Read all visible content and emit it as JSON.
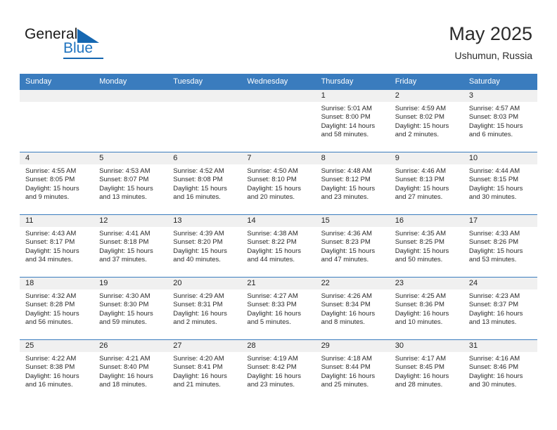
{
  "brand": {
    "name_part1": "General",
    "name_part2": "Blue",
    "logo_icon": "triangle-icon"
  },
  "header": {
    "title": "May 2025",
    "location": "Ushumun, Russia"
  },
  "colors": {
    "header_blue": "#3a7cbe",
    "brand_blue": "#1667b1",
    "daynum_band": "#f0f0f0",
    "text": "#2a2a2a"
  },
  "weekdays": [
    "Sunday",
    "Monday",
    "Tuesday",
    "Wednesday",
    "Thursday",
    "Friday",
    "Saturday"
  ],
  "weeks": [
    [
      {
        "day": "",
        "sunrise": "",
        "sunset": "",
        "daylight_line1": "",
        "daylight_line2": ""
      },
      {
        "day": "",
        "sunrise": "",
        "sunset": "",
        "daylight_line1": "",
        "daylight_line2": ""
      },
      {
        "day": "",
        "sunrise": "",
        "sunset": "",
        "daylight_line1": "",
        "daylight_line2": ""
      },
      {
        "day": "",
        "sunrise": "",
        "sunset": "",
        "daylight_line1": "",
        "daylight_line2": ""
      },
      {
        "day": "1",
        "sunrise": "Sunrise: 5:01 AM",
        "sunset": "Sunset: 8:00 PM",
        "daylight_line1": "Daylight: 14 hours",
        "daylight_line2": "and 58 minutes."
      },
      {
        "day": "2",
        "sunrise": "Sunrise: 4:59 AM",
        "sunset": "Sunset: 8:02 PM",
        "daylight_line1": "Daylight: 15 hours",
        "daylight_line2": "and 2 minutes."
      },
      {
        "day": "3",
        "sunrise": "Sunrise: 4:57 AM",
        "sunset": "Sunset: 8:03 PM",
        "daylight_line1": "Daylight: 15 hours",
        "daylight_line2": "and 6 minutes."
      }
    ],
    [
      {
        "day": "4",
        "sunrise": "Sunrise: 4:55 AM",
        "sunset": "Sunset: 8:05 PM",
        "daylight_line1": "Daylight: 15 hours",
        "daylight_line2": "and 9 minutes."
      },
      {
        "day": "5",
        "sunrise": "Sunrise: 4:53 AM",
        "sunset": "Sunset: 8:07 PM",
        "daylight_line1": "Daylight: 15 hours",
        "daylight_line2": "and 13 minutes."
      },
      {
        "day": "6",
        "sunrise": "Sunrise: 4:52 AM",
        "sunset": "Sunset: 8:08 PM",
        "daylight_line1": "Daylight: 15 hours",
        "daylight_line2": "and 16 minutes."
      },
      {
        "day": "7",
        "sunrise": "Sunrise: 4:50 AM",
        "sunset": "Sunset: 8:10 PM",
        "daylight_line1": "Daylight: 15 hours",
        "daylight_line2": "and 20 minutes."
      },
      {
        "day": "8",
        "sunrise": "Sunrise: 4:48 AM",
        "sunset": "Sunset: 8:12 PM",
        "daylight_line1": "Daylight: 15 hours",
        "daylight_line2": "and 23 minutes."
      },
      {
        "day": "9",
        "sunrise": "Sunrise: 4:46 AM",
        "sunset": "Sunset: 8:13 PM",
        "daylight_line1": "Daylight: 15 hours",
        "daylight_line2": "and 27 minutes."
      },
      {
        "day": "10",
        "sunrise": "Sunrise: 4:44 AM",
        "sunset": "Sunset: 8:15 PM",
        "daylight_line1": "Daylight: 15 hours",
        "daylight_line2": "and 30 minutes."
      }
    ],
    [
      {
        "day": "11",
        "sunrise": "Sunrise: 4:43 AM",
        "sunset": "Sunset: 8:17 PM",
        "daylight_line1": "Daylight: 15 hours",
        "daylight_line2": "and 34 minutes."
      },
      {
        "day": "12",
        "sunrise": "Sunrise: 4:41 AM",
        "sunset": "Sunset: 8:18 PM",
        "daylight_line1": "Daylight: 15 hours",
        "daylight_line2": "and 37 minutes."
      },
      {
        "day": "13",
        "sunrise": "Sunrise: 4:39 AM",
        "sunset": "Sunset: 8:20 PM",
        "daylight_line1": "Daylight: 15 hours",
        "daylight_line2": "and 40 minutes."
      },
      {
        "day": "14",
        "sunrise": "Sunrise: 4:38 AM",
        "sunset": "Sunset: 8:22 PM",
        "daylight_line1": "Daylight: 15 hours",
        "daylight_line2": "and 44 minutes."
      },
      {
        "day": "15",
        "sunrise": "Sunrise: 4:36 AM",
        "sunset": "Sunset: 8:23 PM",
        "daylight_line1": "Daylight: 15 hours",
        "daylight_line2": "and 47 minutes."
      },
      {
        "day": "16",
        "sunrise": "Sunrise: 4:35 AM",
        "sunset": "Sunset: 8:25 PM",
        "daylight_line1": "Daylight: 15 hours",
        "daylight_line2": "and 50 minutes."
      },
      {
        "day": "17",
        "sunrise": "Sunrise: 4:33 AM",
        "sunset": "Sunset: 8:26 PM",
        "daylight_line1": "Daylight: 15 hours",
        "daylight_line2": "and 53 minutes."
      }
    ],
    [
      {
        "day": "18",
        "sunrise": "Sunrise: 4:32 AM",
        "sunset": "Sunset: 8:28 PM",
        "daylight_line1": "Daylight: 15 hours",
        "daylight_line2": "and 56 minutes."
      },
      {
        "day": "19",
        "sunrise": "Sunrise: 4:30 AM",
        "sunset": "Sunset: 8:30 PM",
        "daylight_line1": "Daylight: 15 hours",
        "daylight_line2": "and 59 minutes."
      },
      {
        "day": "20",
        "sunrise": "Sunrise: 4:29 AM",
        "sunset": "Sunset: 8:31 PM",
        "daylight_line1": "Daylight: 16 hours",
        "daylight_line2": "and 2 minutes."
      },
      {
        "day": "21",
        "sunrise": "Sunrise: 4:27 AM",
        "sunset": "Sunset: 8:33 PM",
        "daylight_line1": "Daylight: 16 hours",
        "daylight_line2": "and 5 minutes."
      },
      {
        "day": "22",
        "sunrise": "Sunrise: 4:26 AM",
        "sunset": "Sunset: 8:34 PM",
        "daylight_line1": "Daylight: 16 hours",
        "daylight_line2": "and 8 minutes."
      },
      {
        "day": "23",
        "sunrise": "Sunrise: 4:25 AM",
        "sunset": "Sunset: 8:36 PM",
        "daylight_line1": "Daylight: 16 hours",
        "daylight_line2": "and 10 minutes."
      },
      {
        "day": "24",
        "sunrise": "Sunrise: 4:23 AM",
        "sunset": "Sunset: 8:37 PM",
        "daylight_line1": "Daylight: 16 hours",
        "daylight_line2": "and 13 minutes."
      }
    ],
    [
      {
        "day": "25",
        "sunrise": "Sunrise: 4:22 AM",
        "sunset": "Sunset: 8:38 PM",
        "daylight_line1": "Daylight: 16 hours",
        "daylight_line2": "and 16 minutes."
      },
      {
        "day": "26",
        "sunrise": "Sunrise: 4:21 AM",
        "sunset": "Sunset: 8:40 PM",
        "daylight_line1": "Daylight: 16 hours",
        "daylight_line2": "and 18 minutes."
      },
      {
        "day": "27",
        "sunrise": "Sunrise: 4:20 AM",
        "sunset": "Sunset: 8:41 PM",
        "daylight_line1": "Daylight: 16 hours",
        "daylight_line2": "and 21 minutes."
      },
      {
        "day": "28",
        "sunrise": "Sunrise: 4:19 AM",
        "sunset": "Sunset: 8:42 PM",
        "daylight_line1": "Daylight: 16 hours",
        "daylight_line2": "and 23 minutes."
      },
      {
        "day": "29",
        "sunrise": "Sunrise: 4:18 AM",
        "sunset": "Sunset: 8:44 PM",
        "daylight_line1": "Daylight: 16 hours",
        "daylight_line2": "and 25 minutes."
      },
      {
        "day": "30",
        "sunrise": "Sunrise: 4:17 AM",
        "sunset": "Sunset: 8:45 PM",
        "daylight_line1": "Daylight: 16 hours",
        "daylight_line2": "and 28 minutes."
      },
      {
        "day": "31",
        "sunrise": "Sunrise: 4:16 AM",
        "sunset": "Sunset: 8:46 PM",
        "daylight_line1": "Daylight: 16 hours",
        "daylight_line2": "and 30 minutes."
      }
    ]
  ]
}
